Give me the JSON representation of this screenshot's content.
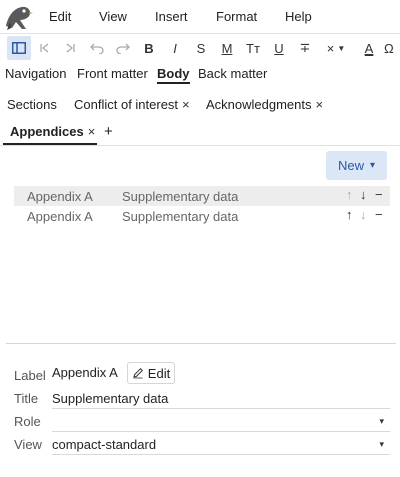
{
  "menubar": {
    "items": [
      "Edit",
      "View",
      "Insert",
      "Format",
      "Help"
    ]
  },
  "toolbar": {
    "bold": "B",
    "italic": "I",
    "strike_s": "S",
    "m": "M",
    "tt": "Tт",
    "u": "U",
    "strike": "∓",
    "x": "×",
    "a": "A",
    "omega": "Ω"
  },
  "tabs_top": [
    "Navigation",
    "Front matter",
    "Body",
    "Back matter"
  ],
  "tabs_sub": [
    "Sections",
    "Conflict of interest",
    "Acknowledgments",
    "Appendices"
  ],
  "close_glyph": "×",
  "add_glyph": "+",
  "new_button": {
    "label": "New",
    "caret": "▾"
  },
  "list": {
    "rows": [
      {
        "label": "Appendix A",
        "title": "Supplementary data"
      },
      {
        "label": "Appendix A",
        "title": "Supplementary data"
      }
    ]
  },
  "row_actions": {
    "up": "↑",
    "down": "↓",
    "remove": "−"
  },
  "form": {
    "label_label": "Label",
    "label_value": "Appendix A",
    "edit_label": "Edit",
    "title_label": "Title",
    "title_value": "Supplementary data",
    "role_label": "Role",
    "role_value": "",
    "view_label": "View",
    "view_value": "compact-standard",
    "caret": "▾"
  },
  "colors": {
    "accent_bg": "#dbe6f6",
    "accent_text": "#2b5aa5",
    "selected_row": "#ededed"
  }
}
